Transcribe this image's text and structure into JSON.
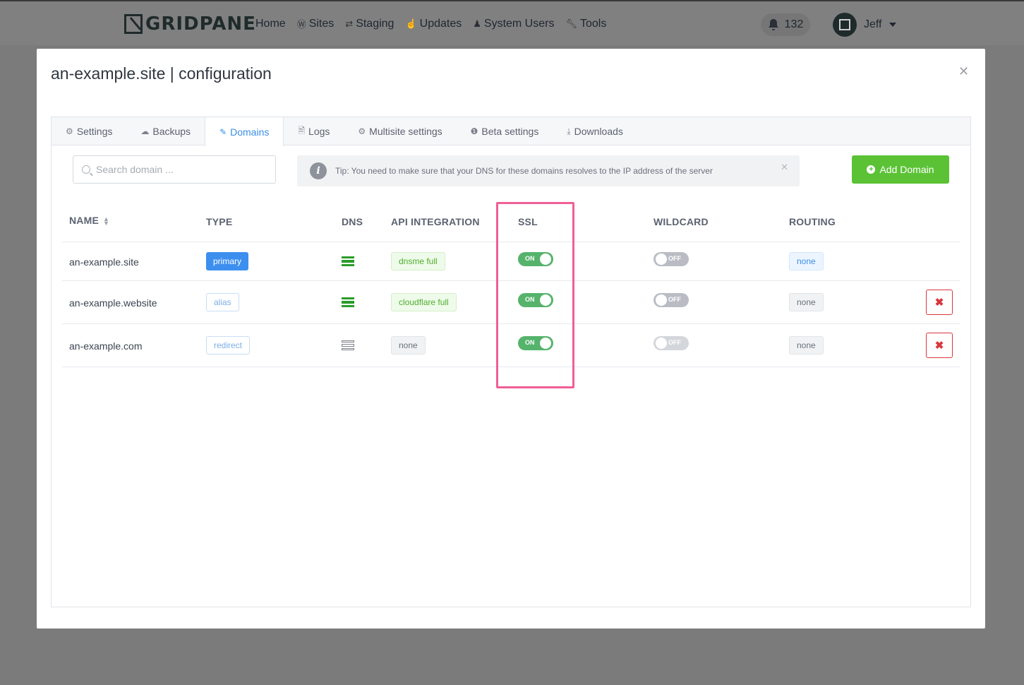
{
  "nav": {
    "logo_text": "GRIDPANE",
    "items": [
      {
        "label": "Home",
        "icon": ""
      },
      {
        "label": "Sites",
        "icon": "wordpress-icon"
      },
      {
        "label": "Staging",
        "icon": "retweet-icon"
      },
      {
        "label": "Updates",
        "icon": "thumbs-up-icon"
      },
      {
        "label": "System Users",
        "icon": "users-icon"
      },
      {
        "label": "Tools",
        "icon": "wrench-icon"
      }
    ],
    "notifications": "132",
    "user": "Jeff"
  },
  "modal": {
    "title": "an-example.site | configuration",
    "tabs": [
      {
        "label": "Settings",
        "icon": "gear-icon"
      },
      {
        "label": "Backups",
        "icon": "cloud-upload-icon"
      },
      {
        "label": "Domains",
        "icon": "edit-icon",
        "active": true
      },
      {
        "label": "Logs",
        "icon": "file-icon"
      },
      {
        "label": "Multisite settings",
        "icon": "gear-icon"
      },
      {
        "label": "Beta settings",
        "icon": "info-circle-icon"
      },
      {
        "label": "Downloads",
        "icon": "download-icon"
      }
    ],
    "search_placeholder": "Search domain ...",
    "tip": "Tip: You need to make sure that your DNS for these domains resolves to the IP address of the server",
    "add_button": "Add Domain"
  },
  "table": {
    "headers": [
      "NAME",
      "TYPE",
      "DNS",
      "API INTEGRATION",
      "SSL",
      "WILDCARD",
      "ROUTING"
    ],
    "rows": [
      {
        "name": "an-example.site",
        "type": "primary",
        "dns": "configured",
        "api": "dnsme full",
        "ssl": "ON",
        "wildcard": "OFF",
        "routing": "none",
        "deletable": false
      },
      {
        "name": "an-example.website",
        "type": "alias",
        "dns": "configured",
        "api": "cloudflare full",
        "ssl": "ON",
        "wildcard": "OFF",
        "routing": "none",
        "deletable": true
      },
      {
        "name": "an-example.com",
        "type": "redirect",
        "dns": "not-configured",
        "api": "none",
        "ssl": "ON",
        "wildcard": "OFF",
        "routing": "none",
        "deletable": true
      }
    ]
  },
  "colors": {
    "accent": "#3a8ee6",
    "success": "#5bc236",
    "toggle_on": "#55b36b",
    "danger": "#d8363b",
    "highlight": "#ef5f96"
  }
}
